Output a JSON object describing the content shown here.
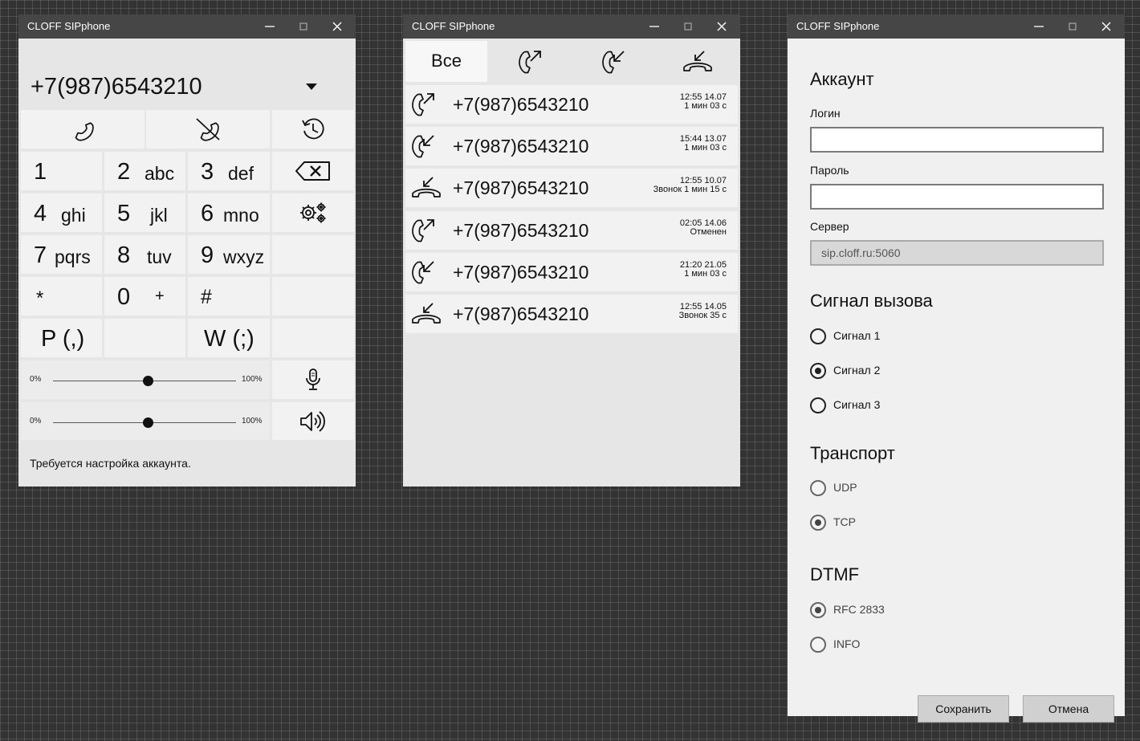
{
  "window_title": "CLOFF SIPphone",
  "dialer": {
    "number": "+7(987)6543210",
    "keys": [
      {
        "digit": "1",
        "letters": ""
      },
      {
        "digit": "2",
        "letters": "abc"
      },
      {
        "digit": "3",
        "letters": "def"
      },
      {
        "digit": "4",
        "letters": "ghi"
      },
      {
        "digit": "5",
        "letters": "jkl"
      },
      {
        "digit": "6",
        "letters": "mno"
      },
      {
        "digit": "7",
        "letters": "pqrs"
      },
      {
        "digit": "8",
        "letters": "tuv"
      },
      {
        "digit": "9",
        "letters": "wxyz"
      },
      {
        "digit": "*",
        "letters": ""
      },
      {
        "digit": "0",
        "letters": "+"
      },
      {
        "digit": "#",
        "letters": ""
      }
    ],
    "pause_key": "P (,)",
    "wait_key": "W (;)",
    "mic_slider": {
      "min_label": "0%",
      "max_label": "100%",
      "value": 0.52
    },
    "speaker_slider": {
      "min_label": "0%",
      "max_label": "100%",
      "value": 0.52
    },
    "status": "Требуется настройка аккаунта."
  },
  "history": {
    "tab_all": "Все",
    "entries": [
      {
        "type": "outgoing",
        "number": "+7(987)6543210",
        "datetime": "12:55 14.07",
        "detail": "1 мин 03 с"
      },
      {
        "type": "incoming",
        "number": "+7(987)6543210",
        "datetime": "15:44 13.07",
        "detail": "1 мин 03 с"
      },
      {
        "type": "missed",
        "number": "+7(987)6543210",
        "datetime": "12:55 10.07",
        "detail": "Звонок 1 мин 15 с"
      },
      {
        "type": "outgoing",
        "number": "+7(987)6543210",
        "datetime": "02:05 14.06",
        "detail": "Отменен"
      },
      {
        "type": "incoming",
        "number": "+7(987)6543210",
        "datetime": "21:20 21.05",
        "detail": "1 мин 03 с"
      },
      {
        "type": "missed",
        "number": "+7(987)6543210",
        "datetime": "12:55 14.05",
        "detail": "Звонок 35 с"
      }
    ]
  },
  "settings": {
    "account_title": "Аккаунт",
    "login_label": "Логин",
    "login_value": "",
    "password_label": "Пароль",
    "password_value": "",
    "server_label": "Сервер",
    "server_value": "sip.cloff.ru:5060",
    "ringtone_title": "Сигнал вызова",
    "ringtones": [
      {
        "label": "Сигнал 1",
        "selected": false
      },
      {
        "label": "Сигнал 2",
        "selected": true
      },
      {
        "label": "Сигнал 3",
        "selected": false
      }
    ],
    "transport_title": "Транспорт",
    "transports": [
      {
        "label": "UDP",
        "selected": false
      },
      {
        "label": "TCP",
        "selected": true
      }
    ],
    "dtmf_title": "DTMF",
    "dtmf": [
      {
        "label": "RFC 2833",
        "selected": true
      },
      {
        "label": "INFO",
        "selected": false
      }
    ],
    "save_label": "Сохранить",
    "cancel_label": "Отмена"
  },
  "icons": [
    "phone-icon",
    "hangup-icon",
    "history-icon",
    "backspace-icon",
    "settings-icon",
    "microphone-icon",
    "speaker-icon",
    "outgoing-call-icon",
    "incoming-call-icon",
    "missed-call-icon"
  ]
}
